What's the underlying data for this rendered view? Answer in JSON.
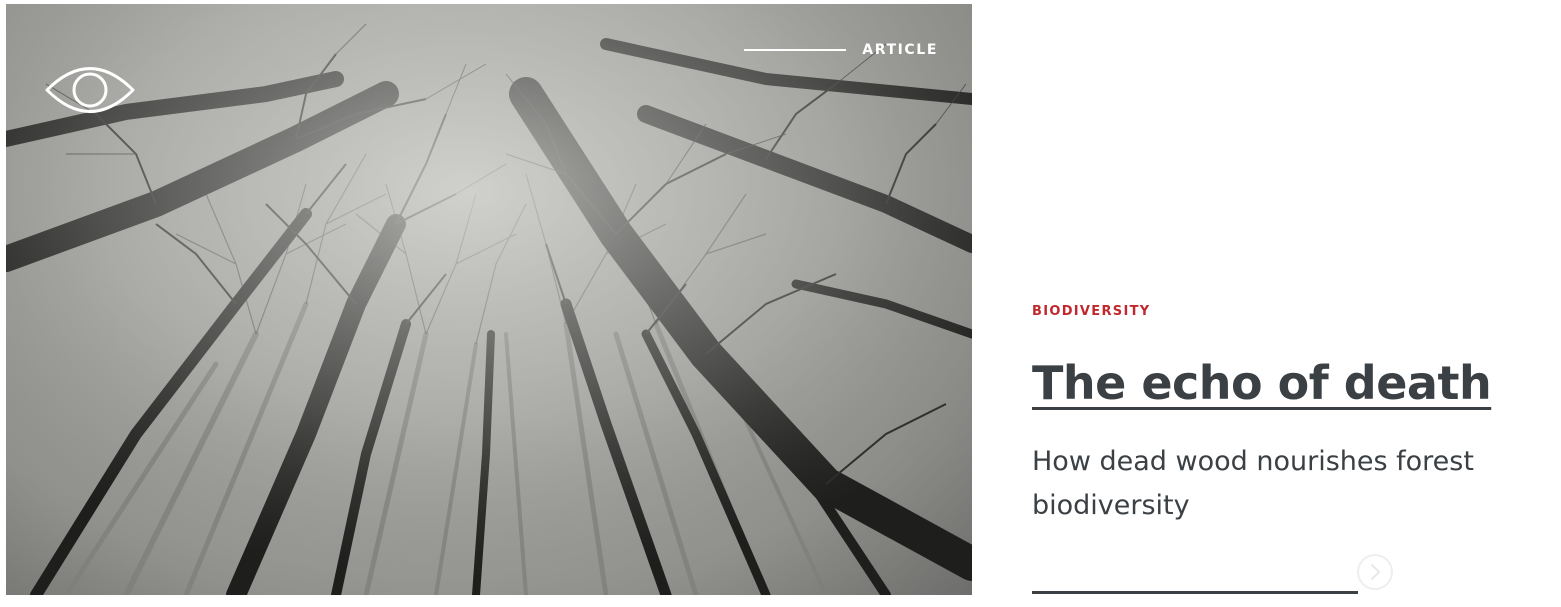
{
  "hero": {
    "image_alt": "Looking up at the bare crowns of tall trees in a misty forest",
    "kicker_label": "ARTICLE",
    "icons": {
      "eye": "eye-icon"
    }
  },
  "article": {
    "category": "BIODIVERSITY",
    "title": "The echo of death",
    "subtitle": "How dead wood nourishes forest biodiversity"
  },
  "controls": {
    "next_icon": "chevron-right-icon"
  },
  "colors": {
    "category": "#c0282e",
    "text": "#3b4044",
    "overlay_text": "#ffffff",
    "background": "#ffffff"
  }
}
